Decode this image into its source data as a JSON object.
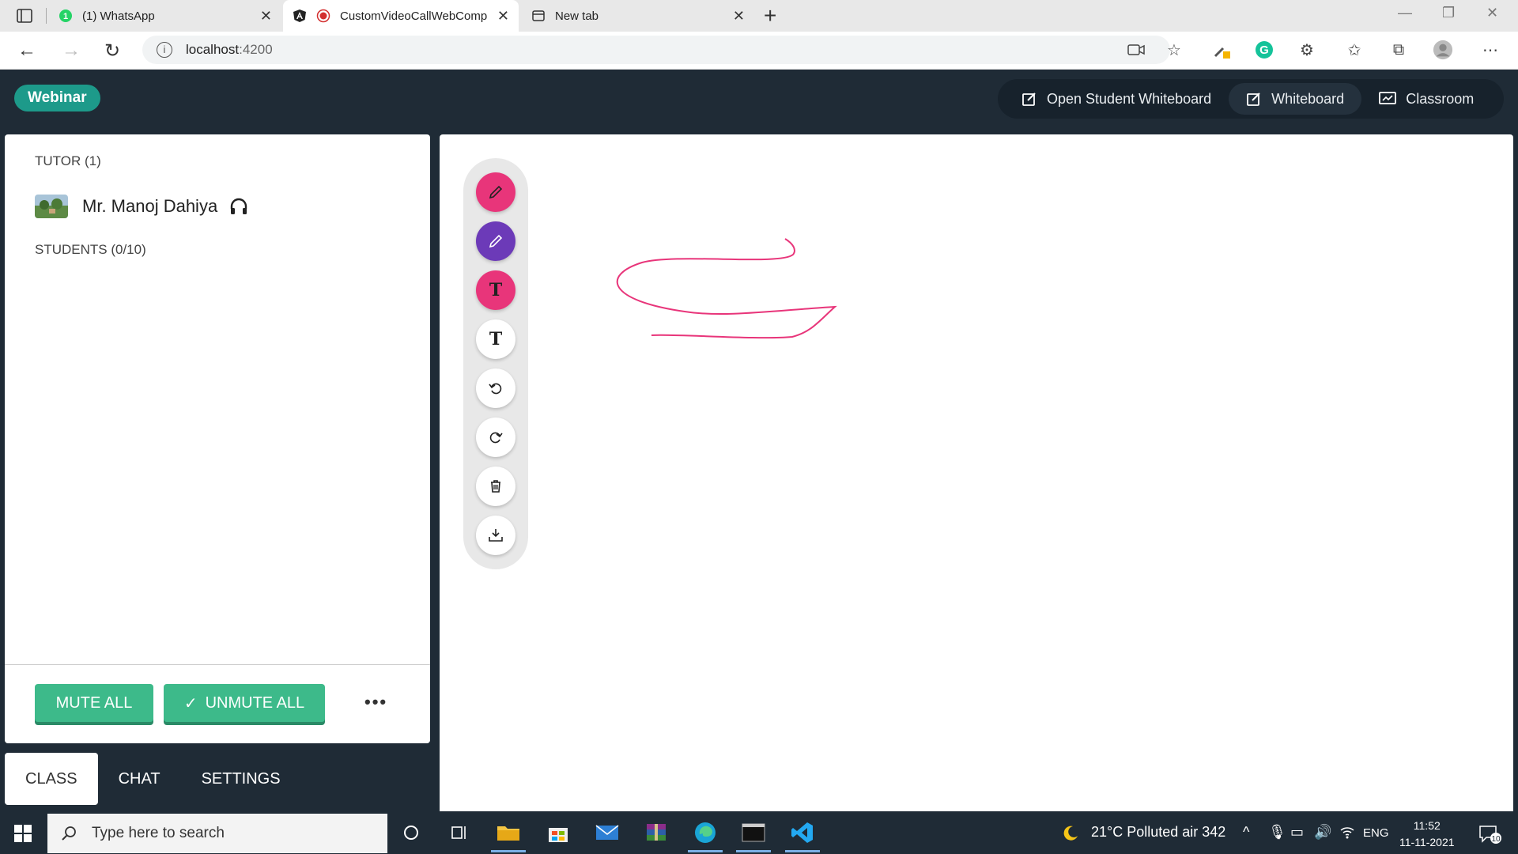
{
  "browser": {
    "tabs": [
      {
        "title": "(1) WhatsApp",
        "icon": "whatsapp-icon"
      },
      {
        "title": "CustomVideoCallWebComp",
        "icon": "angular-icon"
      },
      {
        "title": "New tab",
        "icon": "newtab-icon"
      }
    ],
    "url_host": "localhost",
    "url_port": ":4200"
  },
  "app": {
    "badge": "Webinar",
    "nav": [
      {
        "label": "Open Student Whiteboard",
        "icon": "edit-icon",
        "active": false
      },
      {
        "label": "Whiteboard",
        "icon": "edit-icon",
        "active": true
      },
      {
        "label": "Classroom",
        "icon": "classroom-icon",
        "active": false
      }
    ],
    "panel": {
      "tutor_label": "TUTOR (1)",
      "tutor_name": "Mr. Manoj Dahiya",
      "students_label": "STUDENTS (0/10)",
      "mute_all": "MUTE ALL",
      "unmute_all": "UNMUTE ALL",
      "more": "•••"
    },
    "bottom_tabs": [
      "CLASS",
      "CHAT",
      "SETTINGS"
    ],
    "toolbar": [
      {
        "name": "pen-pink",
        "icon": "pencil-icon",
        "color": "#e8357a"
      },
      {
        "name": "pen-purple",
        "icon": "pencil-icon",
        "color": "#6c3ab8"
      },
      {
        "name": "text-pink",
        "icon": "text-icon",
        "glyph": "T",
        "color": "#e8357a"
      },
      {
        "name": "text-white",
        "icon": "text-icon",
        "glyph": "T",
        "color": "#ffffff"
      },
      {
        "name": "undo",
        "icon": "undo-icon",
        "color": "#ffffff"
      },
      {
        "name": "redo",
        "icon": "redo-icon",
        "color": "#ffffff"
      },
      {
        "name": "clear",
        "icon": "trash-icon",
        "color": "#ffffff"
      },
      {
        "name": "download",
        "icon": "download-icon",
        "color": "#ffffff"
      }
    ],
    "stroke_color": "#e8357a"
  },
  "taskbar": {
    "search_placeholder": "Type here to search",
    "weather": "21°C  Polluted air 342",
    "lang": "ENG",
    "time": "11:52",
    "date": "11-11-2021",
    "notifications": "10"
  }
}
